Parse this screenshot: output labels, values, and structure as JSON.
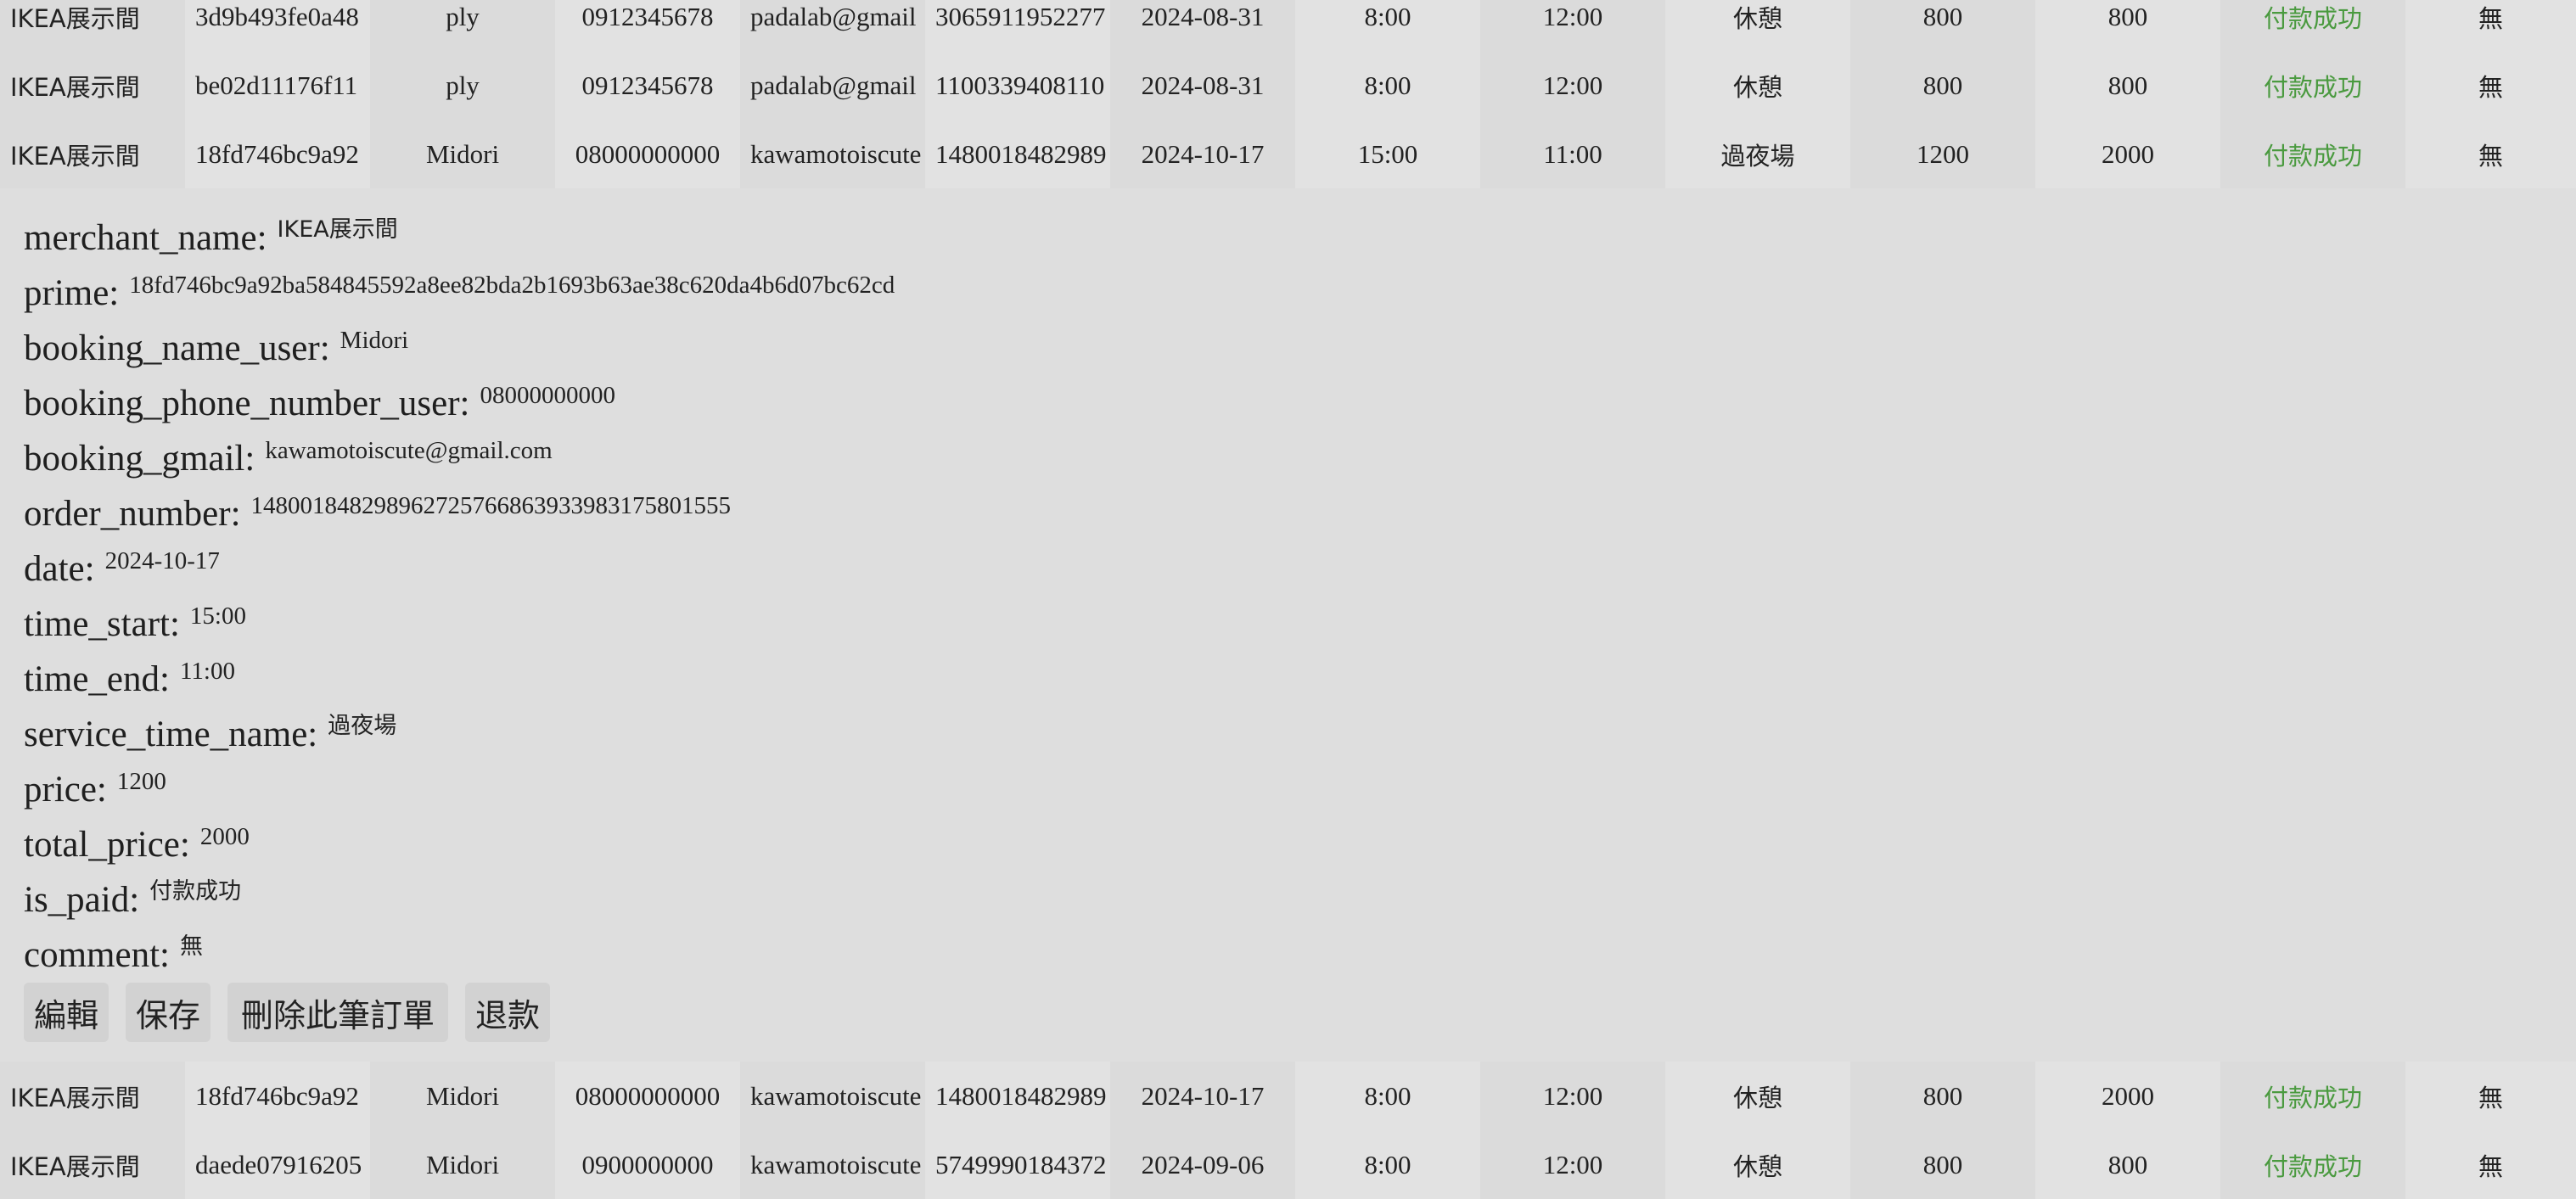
{
  "columns": {
    "lefts": [
      0,
      218,
      436,
      654,
      872,
      1090,
      1308,
      1526,
      1744,
      1962,
      2180,
      2398,
      2616,
      2834
    ],
    "widths": [
      218,
      218,
      218,
      218,
      218,
      218,
      218,
      218,
      218,
      218,
      218,
      218,
      218,
      201
    ]
  },
  "rows_top": [
    [
      "IKEA展示間",
      "3d9b493fe0a48",
      "ply",
      "0912345678",
      "padalab@gmail",
      "3065911952277",
      "2024-08-31",
      "8:00",
      "12:00",
      "休憩",
      "800",
      "800",
      "付款成功",
      "無"
    ],
    [
      "IKEA展示間",
      "be02d11176f11",
      "ply",
      "0912345678",
      "padalab@gmail",
      "1100339408110",
      "2024-08-31",
      "8:00",
      "12:00",
      "休憩",
      "800",
      "800",
      "付款成功",
      "無"
    ],
    [
      "IKEA展示間",
      "18fd746bc9a92",
      "Midori",
      "08000000000",
      "kawamotoiscute",
      "1480018482989",
      "2024-10-17",
      "15:00",
      "11:00",
      "過夜場",
      "1200",
      "2000",
      "付款成功",
      "無"
    ]
  ],
  "rows_bottom": [
    [
      "IKEA展示間",
      "18fd746bc9a92",
      "Midori",
      "08000000000",
      "kawamotoiscute",
      "1480018482989",
      "2024-10-17",
      "8:00",
      "12:00",
      "休憩",
      "800",
      "2000",
      "付款成功",
      "無"
    ],
    [
      "IKEA展示間",
      "daede07916205",
      "Midori",
      "0900000000",
      "kawamotoiscute",
      "5749990184372",
      "2024-09-06",
      "8:00",
      "12:00",
      "休憩",
      "800",
      "800",
      "付款成功",
      "無"
    ]
  ],
  "detail": {
    "fields": [
      {
        "key": "merchant_name:",
        "value": "IKEA展示間"
      },
      {
        "key": "prime:",
        "value": "18fd746bc9a92ba584845592a8ee82bda2b1693b63ae38c620da4b6d07bc62cd"
      },
      {
        "key": "booking_name_user:",
        "value": "Midori"
      },
      {
        "key": "booking_phone_number_user:",
        "value": "08000000000"
      },
      {
        "key": "booking_gmail:",
        "value": "kawamotoiscute@gmail.com"
      },
      {
        "key": "order_number:",
        "value": "14800184829896272576686393398317580155​5"
      },
      {
        "key": "date:",
        "value": "2024-10-17"
      },
      {
        "key": "time_start:",
        "value": "15:00"
      },
      {
        "key": "time_end:",
        "value": "11:00"
      },
      {
        "key": "service_time_name:",
        "value": "過夜場"
      },
      {
        "key": "price:",
        "value": "1200"
      },
      {
        "key": "total_price:",
        "value": "2000"
      },
      {
        "key": "is_paid:",
        "value": "付款成功"
      },
      {
        "key": "comment:",
        "value": "無"
      }
    ],
    "buttons": {
      "edit": "編輯",
      "save": "保存",
      "delete": "刪除此筆訂單",
      "refund": "退款"
    }
  },
  "colors": {
    "background": "#dedede",
    "paid_status": "#4a9a3f"
  }
}
